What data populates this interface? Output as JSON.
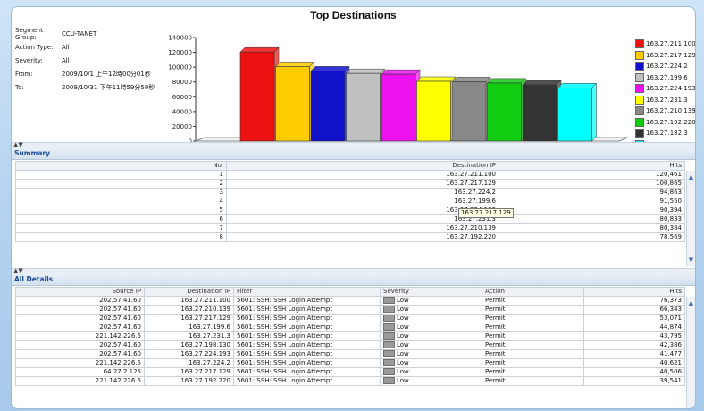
{
  "title": "Top Destinations",
  "meta": [
    {
      "k": "Segment Group:",
      "v": "CCU-TANET"
    },
    {
      "k": "Action Type:",
      "v": "All"
    },
    {
      "k": "Severity:",
      "v": "All"
    },
    {
      "k": "From:",
      "v": "2009/10/1 上午12時00分01秒"
    },
    {
      "k": "To:",
      "v": "2009/10/31 下午11時59分59秒"
    }
  ],
  "chart_data": {
    "type": "bar",
    "categories": [
      "163.27.211.100",
      "163.27.217.129",
      "163.27.224.2",
      "163.27.199.6",
      "163.27.224.193",
      "163.27.231.3",
      "163.27.210.139",
      "163.27.192.220",
      "163.27.182.3",
      "163.27.198.130"
    ],
    "values": [
      120461,
      100865,
      94863,
      91550,
      90394,
      80833,
      80384,
      78569,
      76000,
      72000
    ],
    "colors": [
      "#ee1111",
      "#ffcc00",
      "#1111cc",
      "#c0c0c0",
      "#ee11ee",
      "#ffff00",
      "#888888",
      "#11cc11",
      "#333333",
      "#00ffff"
    ],
    "yticks": [
      "140000",
      "120000",
      "100000",
      "80000",
      "60000",
      "40000",
      "20000",
      "0"
    ],
    "ylim": [
      0,
      140000
    ]
  },
  "summary": {
    "label": "Summary",
    "headers": [
      "No.",
      "Destination IP",
      "Hits"
    ],
    "rows": [
      [
        "1",
        "163.27.211.100",
        "120,461"
      ],
      [
        "2",
        "163.27.217.129",
        "100,865"
      ],
      [
        "3",
        "163.27.224.2",
        "94,863"
      ],
      [
        "4",
        "163.27.199.6",
        "91,550"
      ],
      [
        "5",
        "163.27.224.193",
        "90,394"
      ],
      [
        "6",
        "163.27.231.3",
        "80,833"
      ],
      [
        "7",
        "163.27.210.139",
        "80,384"
      ],
      [
        "8",
        "163.27.192.220",
        "78,569"
      ]
    ],
    "tooltip": "163.27.217.129"
  },
  "details": {
    "label": "All Details",
    "headers": [
      "Source IP",
      "Destination IP",
      "Filter",
      "Severity",
      "Action",
      "Hits"
    ],
    "rows": [
      [
        "202.57.41.60",
        "163.27.211.100",
        "5601: SSH: SSH Login Attempt",
        "Low",
        "Permit",
        "76,373"
      ],
      [
        "202.57.41.60",
        "163.27.210.139",
        "5601: SSH: SSH Login Attempt",
        "Low",
        "Permit",
        "66,343"
      ],
      [
        "202.57.41.60",
        "163.27.217.129",
        "5601: SSH: SSH Login Attempt",
        "Low",
        "Permit",
        "53,071"
      ],
      [
        "202.57.41.60",
        "163.27.199.6",
        "5601: SSH: SSH Login Attempt",
        "Low",
        "Permit",
        "44,874"
      ],
      [
        "221.142.226.5",
        "163.27.231.3",
        "5601: SSH: SSH Login Attempt",
        "Low",
        "Permit",
        "43,795"
      ],
      [
        "202.57.41.60",
        "163.27.198.130",
        "5601: SSH: SSH Login Attempt",
        "Low",
        "Permit",
        "42,386"
      ],
      [
        "202.57.41.60",
        "163.27.224.193",
        "5601: SSH: SSH Login Attempt",
        "Low",
        "Permit",
        "41,477"
      ],
      [
        "221.142.226.5",
        "163.27.224.2",
        "5601: SSH: SSH Login Attempt",
        "Low",
        "Permit",
        "40,621"
      ],
      [
        "64.27.2.125",
        "163.27.217.129",
        "5601: SSH: SSH Login Attempt",
        "Low",
        "Permit",
        "40,506"
      ],
      [
        "221.142.226.5",
        "163.27.192.220",
        "5601: SSH: SSH Login Attempt",
        "Low",
        "Permit",
        "39,541"
      ]
    ]
  }
}
